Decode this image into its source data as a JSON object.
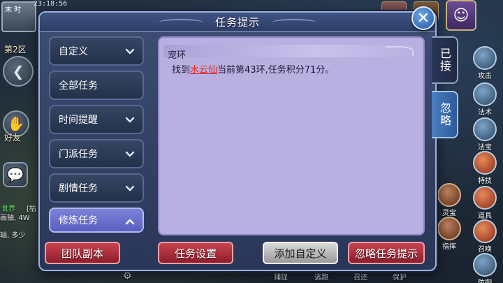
{
  "status_bar": {
    "time": "23:18:56"
  },
  "hud": {
    "player_tag": "末 时",
    "map_label": "第2区",
    "friends_label": "好友",
    "chat_channel": "世界",
    "chat_line_1": "[枯",
    "chat_line_2": "画轴, 4W",
    "chat_line_3": "轴, 多少",
    "right_skills": [
      "攻击",
      "法术",
      "法宝",
      "特技",
      "道具",
      "召唤",
      "防御"
    ],
    "mid_skills": [
      "灵宝",
      "指挥"
    ],
    "bottom_actions": [
      "捕捉",
      "逃跑",
      "召还",
      "保护"
    ]
  },
  "modal": {
    "title": "任务提示",
    "close_icon": "close-icon",
    "categories": [
      {
        "label": "自定义",
        "icon": "chevron-down-icon",
        "active": false
      },
      {
        "label": "全部任务",
        "icon": "",
        "active": false
      },
      {
        "label": "时间提醒",
        "icon": "chevron-down-icon",
        "active": false
      },
      {
        "label": "门派任务",
        "icon": "chevron-down-icon",
        "active": false
      },
      {
        "label": "剧情任务",
        "icon": "chevron-down-icon",
        "active": false
      },
      {
        "label": "修炼任务",
        "icon": "chevron-up-icon",
        "active": true
      }
    ],
    "content": {
      "header": "宠环",
      "text_prefix": "找到",
      "npc_name": "水云仙",
      "text_suffix": "当前第43环,任务积分71分。"
    },
    "side_tabs": [
      {
        "label": "已接",
        "selected": true
      },
      {
        "label": "忽略",
        "selected": false
      }
    ],
    "buttons": {
      "team_dungeon": "团队副本",
      "task_settings": "任务设置",
      "add_custom": "添加自定义",
      "ignore_prompt": "忽略任务提示"
    }
  },
  "colors": {
    "modal_bg": "#3d4e73",
    "content_bg": "#b7b0e0",
    "active_category": "#6b72cc",
    "npc_link": "#e0231f",
    "button_red": "#a82c3a",
    "button_gray": "#bdbdbd"
  }
}
